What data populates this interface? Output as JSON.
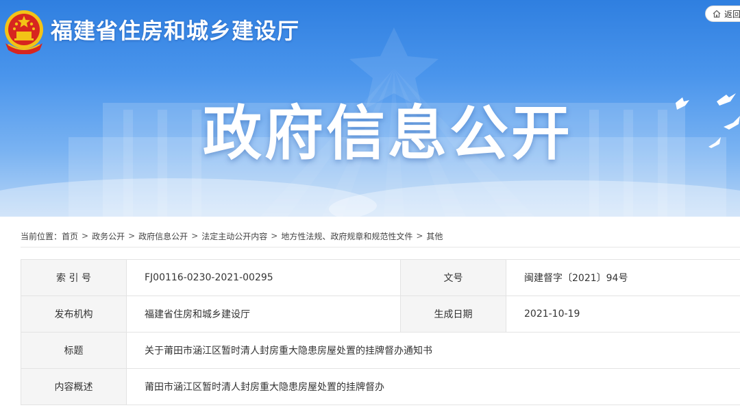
{
  "header": {
    "site_title": "福建省住房和城乡建设厅",
    "back_label": "返回",
    "banner_heading": "政府信息公开",
    "emblem_icon": "national-emblem-icon",
    "colors": {
      "banner_top": "#2f7fe0",
      "banner_bottom": "#b9d6f6",
      "emblem_red": "#d7261f",
      "emblem_gold": "#f3c316"
    }
  },
  "breadcrumb": {
    "prefix": "当前位置：",
    "items": [
      "首页",
      "政务公开",
      "政府信息公开",
      "法定主动公开内容",
      "地方性法规、政府规章和规范性文件",
      "其他"
    ],
    "separator": ">"
  },
  "info": {
    "index_label": "索 引 号",
    "index_value": "FJ00116-0230-2021-00295",
    "doc_no_label": "文号",
    "doc_no_value": "闽建督字〔2021〕94号",
    "publisher_label": "发布机构",
    "publisher_value": "福建省住房和城乡建设厅",
    "date_label": "生成日期",
    "date_value": "2021-10-19",
    "title_label": "标题",
    "title_value": "关于莆田市涵江区暂时清人封房重大隐患房屋处置的挂牌督办通知书",
    "summary_label": "内容概述",
    "summary_value": "莆田市涵江区暂时清人封房重大隐患房屋处置的挂牌督办"
  }
}
